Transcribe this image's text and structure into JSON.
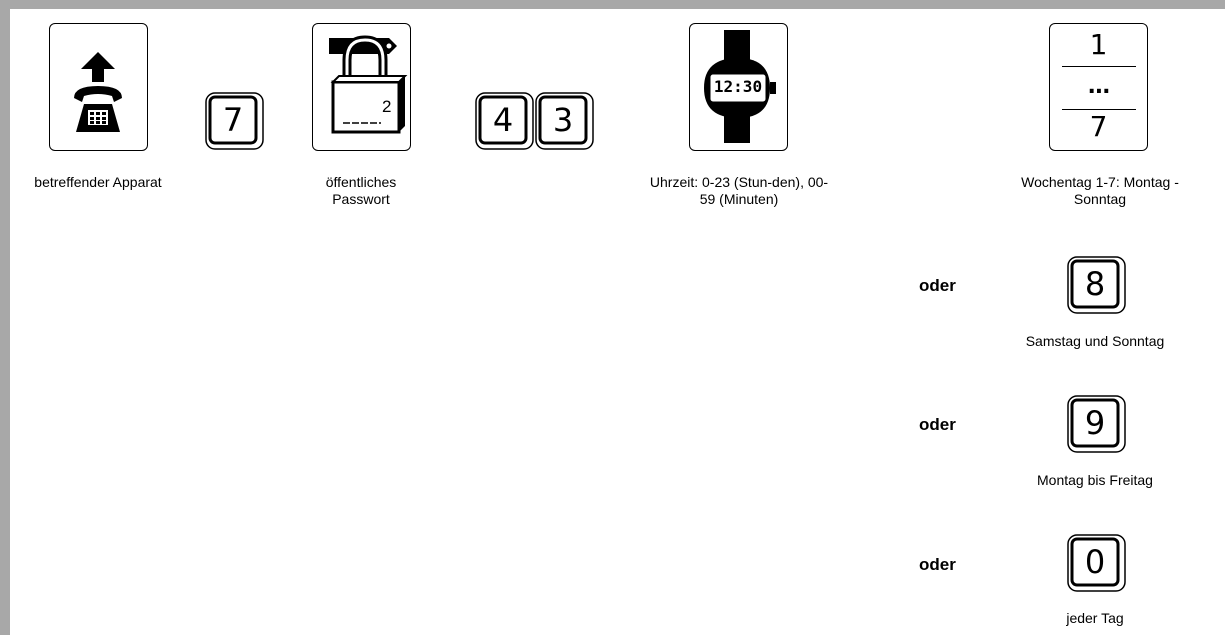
{
  "steps": {
    "phone": {
      "caption": "betreffender Apparat"
    },
    "key_7": {
      "digit": "7"
    },
    "lock": {
      "caption": "öffentliches Passwort",
      "superscript": "2"
    },
    "key_4": {
      "digit": "4"
    },
    "key_3": {
      "digit": "3"
    },
    "watch": {
      "time": "12:30",
      "caption": "Uhrzeit: 0-23 (Stun-den), 00-59 (Minuten)"
    },
    "weekday": {
      "top": "1",
      "middle": "...",
      "bottom": "7",
      "caption": "Wochentag 1-7: Montag - Sonntag"
    }
  },
  "alternatives": [
    {
      "connector": "oder",
      "digit": "8",
      "caption": "Samstag und Sonntag"
    },
    {
      "connector": "oder",
      "digit": "9",
      "caption": "Montag bis Freitag"
    },
    {
      "connector": "oder",
      "digit": "0",
      "caption": "jeder Tag"
    }
  ]
}
